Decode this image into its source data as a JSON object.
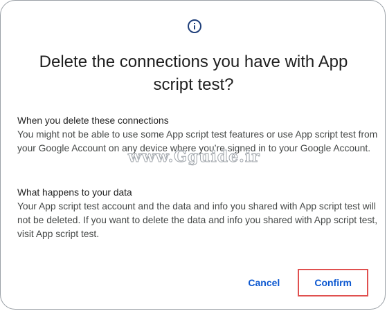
{
  "dialog": {
    "icon": "info-icon",
    "title": "Delete the connections you have with App script test?",
    "sections": [
      {
        "heading": "When you delete these connections",
        "body": "You might not be able to use some App script test features or use App script test from your Google Account on any device where you’re signed in to your Google Account."
      },
      {
        "heading": "What happens to your data",
        "body": "Your App script test account and the data and info you shared with App script test will not be deleted. If you want to delete the data and info you shared with App script test, visit App script test."
      }
    ],
    "watermark": "www.Gguide.ir",
    "actions": {
      "cancel_label": "Cancel",
      "confirm_label": "Confirm"
    }
  },
  "colors": {
    "accent": "#0b57d0",
    "highlight": "#e0504f",
    "text": "#1f1f1f",
    "body_text": "#444746"
  }
}
